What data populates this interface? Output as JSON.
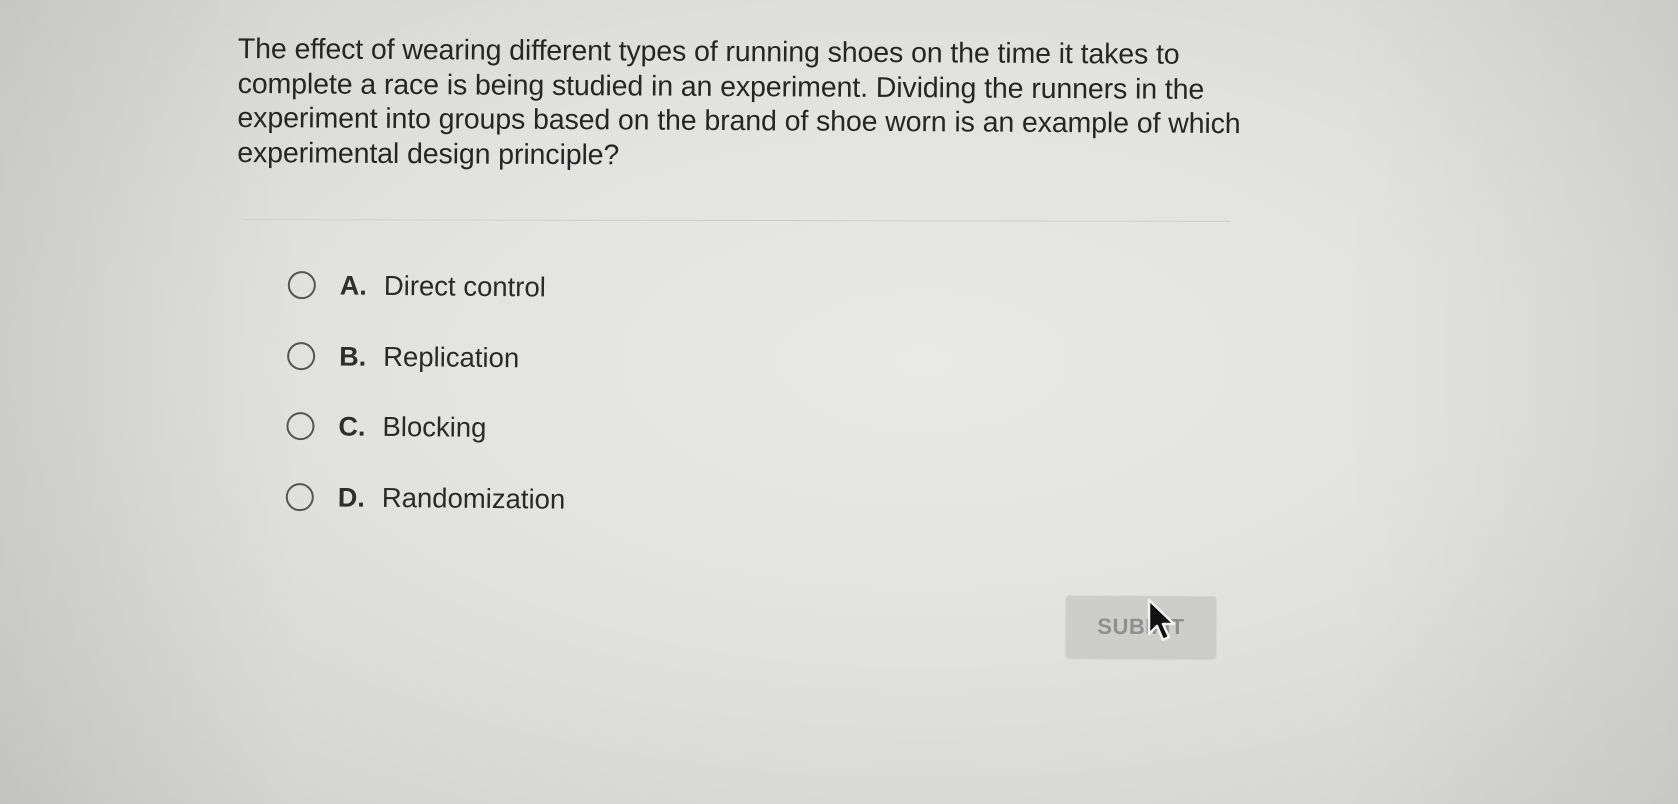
{
  "question": {
    "text": "The effect of wearing different types of running shoes on the time it takes to complete a race is being studied in an experiment. Dividing the runners in the experiment into groups based on the brand of shoe worn is an example of which experimental design principle?"
  },
  "options": [
    {
      "letter": "A.",
      "text": "Direct control"
    },
    {
      "letter": "B.",
      "text": "Replication"
    },
    {
      "letter": "C.",
      "text": "Blocking"
    },
    {
      "letter": "D.",
      "text": "Randomization"
    }
  ],
  "submit": {
    "label": "SUBMIT",
    "state": "disabled"
  },
  "icons": {
    "radio": "radio-unchecked-icon",
    "cursor": "mouse-pointer-icon"
  },
  "colors": {
    "background": "#e2e2df",
    "text": "#262626",
    "radio_border": "#555555",
    "submit_bg": "#cdcdca",
    "submit_text": "#8f8f8f"
  }
}
